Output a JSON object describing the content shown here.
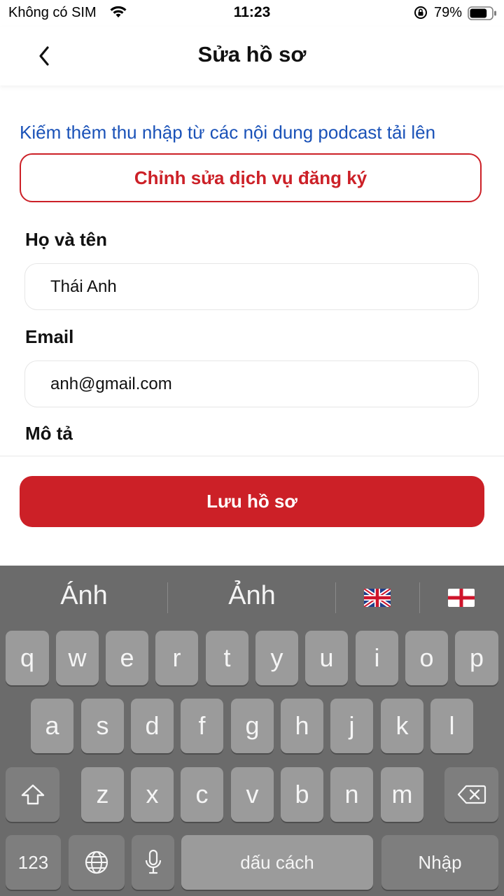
{
  "status_bar": {
    "carrier": "Không có SIM",
    "time": "11:23",
    "battery_percent": "79%",
    "battery_level": 0.79
  },
  "header": {
    "title": "Sửa hồ sơ",
    "back_icon": "chevron-left-icon"
  },
  "promo_link": "Kiếm thêm thu nhập từ các nội dung podcast tải lên",
  "edit_subscription_button": "Chỉnh sửa dịch vụ đăng ký",
  "form": {
    "name_label": "Họ và tên",
    "name_value": "Thái Anh",
    "email_label": "Email",
    "email_value": "anh@gmail.com",
    "description_label": "Mô tả"
  },
  "save_button": "Lưu hồ sơ",
  "colors": {
    "accent": "#cc2027",
    "link": "#1a52b8",
    "keyboard_bg": "#6b6b6b",
    "key_bg": "#9b9b9b"
  },
  "keyboard": {
    "suggestions": [
      "Ánh",
      "Ảnh"
    ],
    "emoji_suggestions": [
      "uk-flag-icon",
      "england-flag-icon"
    ],
    "row1": [
      "q",
      "w",
      "e",
      "r",
      "t",
      "y",
      "u",
      "i",
      "o",
      "p"
    ],
    "row2": [
      "a",
      "s",
      "d",
      "f",
      "g",
      "h",
      "j",
      "k",
      "l"
    ],
    "row3": [
      "z",
      "x",
      "c",
      "v",
      "b",
      "n",
      "m"
    ],
    "numbers_key": "123",
    "space_key": "dấu cách",
    "return_key": "Nhập"
  }
}
